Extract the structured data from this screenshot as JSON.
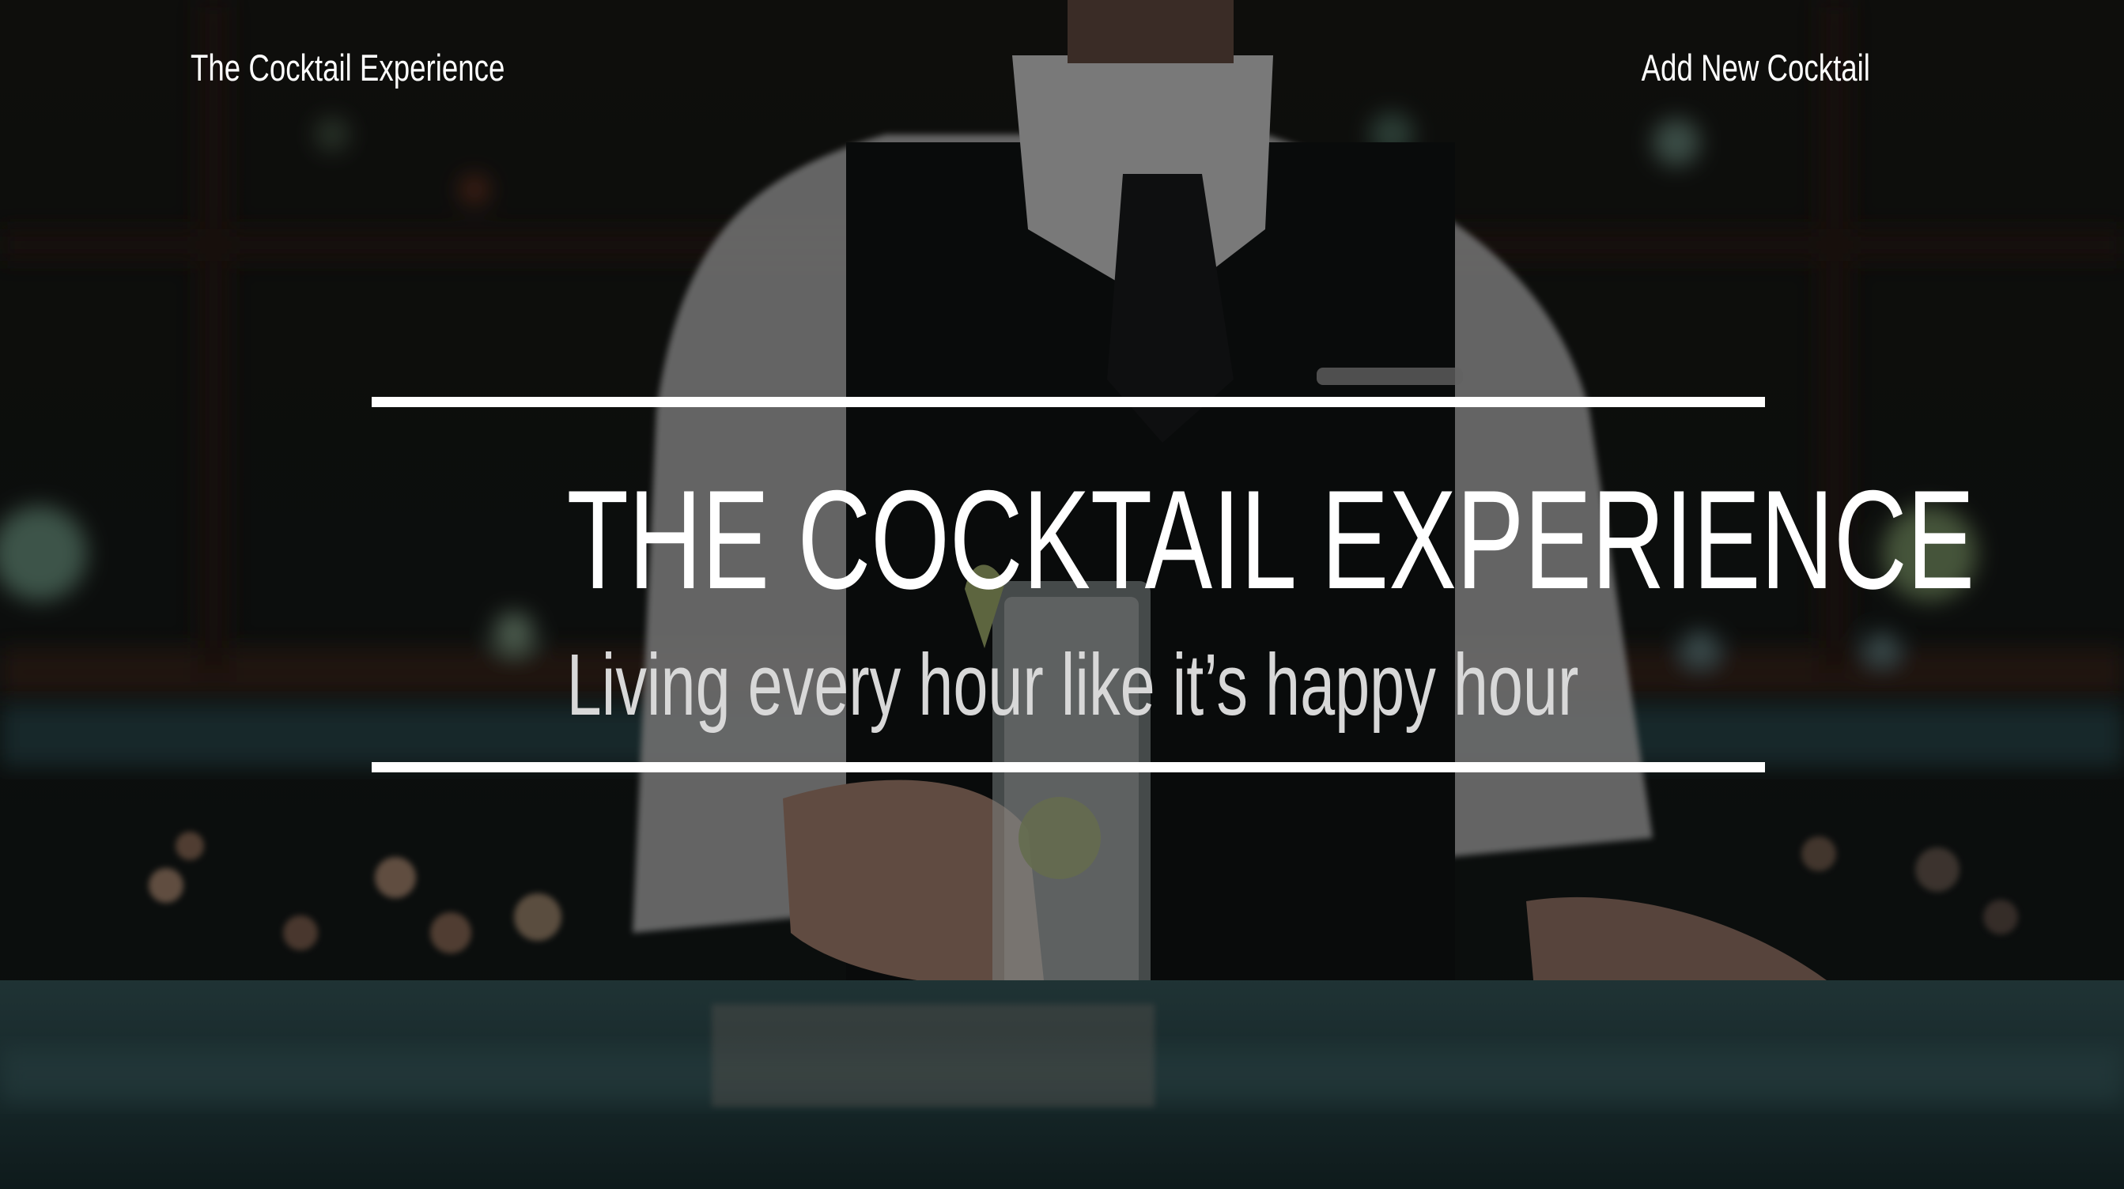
{
  "nav": {
    "brand": "The Cocktail Experience",
    "add_link": "Add New Cocktail"
  },
  "hero": {
    "title": "THE COCKTAIL EXPERIENCE",
    "subtitle": "Living every hour like it’s happy hour"
  },
  "colors": {
    "text": "#ffffff",
    "subtitle": "#d8d8d8",
    "overlay": "#000000",
    "bar_counter": "#2f5356"
  }
}
